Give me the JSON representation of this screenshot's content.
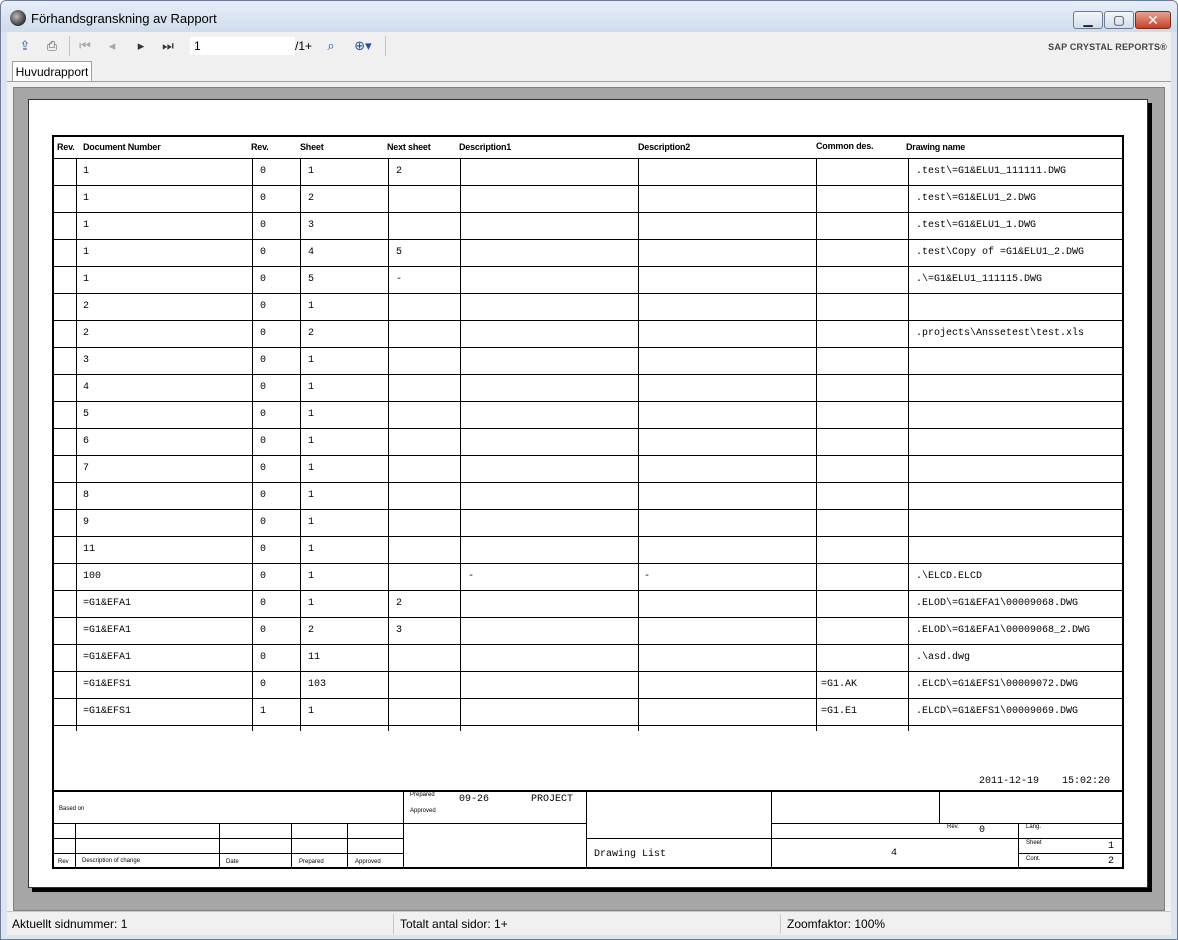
{
  "window": {
    "title": "Förhandsgranskning av Rapport"
  },
  "toolbar": {
    "export_icon": "export-icon",
    "print_icon": "print-icon",
    "first_icon": "first-page-icon",
    "prev_icon": "prev-page-icon",
    "next_icon": "next-page-icon",
    "last_icon": "last-page-icon",
    "page_value": "1",
    "page_total": "/1+",
    "find_icon": "binoculars-icon",
    "zoom_icon": "zoom-icon",
    "brand": "SAP CRYSTAL REPORTS®"
  },
  "tabs": [
    "Huvudrapport"
  ],
  "report": {
    "headers": {
      "rev": "Rev.",
      "document_number": "Document Number",
      "rev2": "Rev.",
      "sheet": "Sheet",
      "next_sheet": "Next sheet",
      "description1": "Description1",
      "description2": "Description2",
      "common_des": "Common des.",
      "drawing_name": "Drawing name"
    },
    "rows": [
      {
        "doc": "1",
        "rev": "0",
        "sheet": "1",
        "next": "2",
        "d1": "",
        "d2": "",
        "common": "",
        "drawing": ".test\\=G1&ELU1_111111.DWG"
      },
      {
        "doc": "1",
        "rev": "0",
        "sheet": "2",
        "next": "",
        "d1": "",
        "d2": "",
        "common": "",
        "drawing": ".test\\=G1&ELU1_2.DWG"
      },
      {
        "doc": "1",
        "rev": "0",
        "sheet": "3",
        "next": "",
        "d1": "",
        "d2": "",
        "common": "",
        "drawing": ".test\\=G1&ELU1_1.DWG"
      },
      {
        "doc": "1",
        "rev": "0",
        "sheet": "4",
        "next": "5",
        "d1": "",
        "d2": "",
        "common": "",
        "drawing": ".test\\Copy of =G1&ELU1_2.DWG"
      },
      {
        "doc": "1",
        "rev": "0",
        "sheet": "5",
        "next": "-",
        "d1": "",
        "d2": "",
        "common": "",
        "drawing": ".\\=G1&ELU1_111115.DWG"
      },
      {
        "doc": "2",
        "rev": "0",
        "sheet": "1",
        "next": "",
        "d1": "",
        "d2": "",
        "common": "",
        "drawing": ""
      },
      {
        "doc": "2",
        "rev": "0",
        "sheet": "2",
        "next": "",
        "d1": "",
        "d2": "",
        "common": "",
        "drawing": ".projects\\Anssetest\\test.xls"
      },
      {
        "doc": "3",
        "rev": "0",
        "sheet": "1",
        "next": "",
        "d1": "",
        "d2": "",
        "common": "",
        "drawing": ""
      },
      {
        "doc": "4",
        "rev": "0",
        "sheet": "1",
        "next": "",
        "d1": "",
        "d2": "",
        "common": "",
        "drawing": ""
      },
      {
        "doc": "5",
        "rev": "0",
        "sheet": "1",
        "next": "",
        "d1": "",
        "d2": "",
        "common": "",
        "drawing": ""
      },
      {
        "doc": "6",
        "rev": "0",
        "sheet": "1",
        "next": "",
        "d1": "",
        "d2": "",
        "common": "",
        "drawing": ""
      },
      {
        "doc": "7",
        "rev": "0",
        "sheet": "1",
        "next": "",
        "d1": "",
        "d2": "",
        "common": "",
        "drawing": ""
      },
      {
        "doc": "8",
        "rev": "0",
        "sheet": "1",
        "next": "",
        "d1": "",
        "d2": "",
        "common": "",
        "drawing": ""
      },
      {
        "doc": "9",
        "rev": "0",
        "sheet": "1",
        "next": "",
        "d1": "",
        "d2": "",
        "common": "",
        "drawing": ""
      },
      {
        "doc": "11",
        "rev": "0",
        "sheet": "1",
        "next": "",
        "d1": "",
        "d2": "",
        "common": "",
        "drawing": ""
      },
      {
        "doc": "100",
        "rev": "0",
        "sheet": "1",
        "next": "",
        "d1": "-",
        "d2": "-",
        "common": "",
        "drawing": ".\\ELCD.ELCD"
      },
      {
        "doc": "=G1&EFA1",
        "rev": "0",
        "sheet": "1",
        "next": "2",
        "d1": "",
        "d2": "",
        "common": "",
        "drawing": ".ELOD\\=G1&EFA1\\00009068.DWG"
      },
      {
        "doc": "=G1&EFA1",
        "rev": "0",
        "sheet": "2",
        "next": "3",
        "d1": "",
        "d2": "",
        "common": "",
        "drawing": ".ELOD\\=G1&EFA1\\00009068_2.DWG"
      },
      {
        "doc": "=G1&EFA1",
        "rev": "0",
        "sheet": "11",
        "next": "",
        "d1": "",
        "d2": "",
        "common": "",
        "drawing": ".\\asd.dwg"
      },
      {
        "doc": "=G1&EFS1",
        "rev": "0",
        "sheet": "103",
        "next": "",
        "d1": "",
        "d2": "",
        "common": "=G1.AK",
        "drawing": ".ELCD\\=G1&EFS1\\00009072.DWG"
      },
      {
        "doc": "=G1&EFS1",
        "rev": "1",
        "sheet": "1",
        "next": "",
        "d1": "",
        "d2": "",
        "common": "=G1.E1",
        "drawing": ".ELCD\\=G1&EFS1\\00009069.DWG"
      }
    ],
    "date": "2011-12-19",
    "time": "15:02:20",
    "title_block": {
      "based_on": "Based on",
      "prepared_label": "Prepared",
      "prepared_value": "09-26",
      "project": "PROJECT",
      "approved_label": "Approved",
      "rev_col": "Rev",
      "description_of_change": "Description of change",
      "date_col": "Date",
      "prepared_col": "Prepared",
      "approved_col": "Approved",
      "drawing_list": "Drawing List",
      "number": "4",
      "rev_label": "Rev.",
      "rev_value": "0",
      "lang_label": "Lang.",
      "sheet_label": "Sheet",
      "sheet_value": "1",
      "cont_label": "Cont.",
      "cont_value": "2"
    }
  },
  "statusbar": {
    "current_page": "Aktuellt sidnummer: 1",
    "total_pages": "Totalt antal sidor: 1+",
    "zoom": "Zoomfaktor: 100%"
  }
}
